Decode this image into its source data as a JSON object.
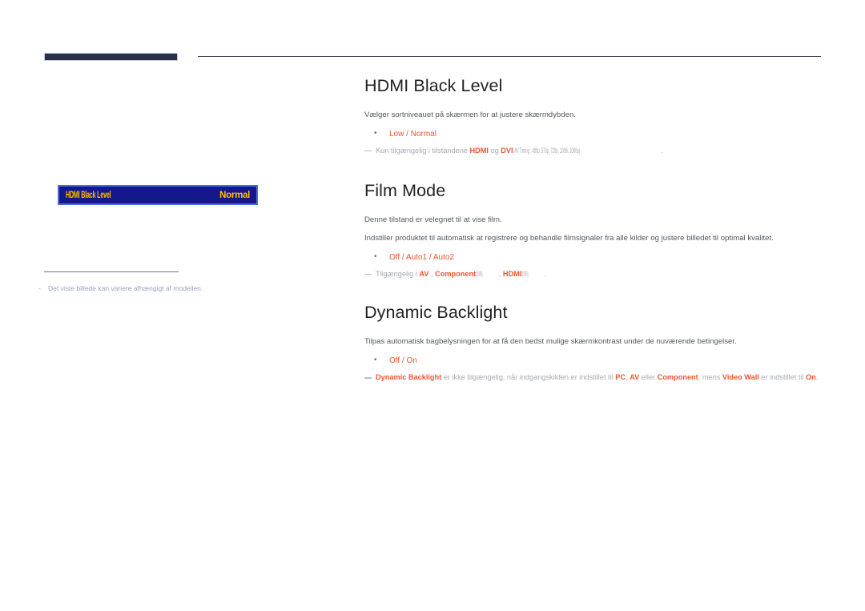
{
  "page": {
    "language": "Danish",
    "left_panel": {
      "osd": {
        "label": "HDMI Black Level",
        "value": "Normal",
        "bg_color": "#14188c",
        "border_color": "#4a6fd4",
        "text_color": "#ffc000"
      },
      "footnote": {
        "bullet": "-",
        "text": "Det viste billede kan variere afhængigt af modellen."
      }
    },
    "sections": [
      {
        "id": "hdmi-black-level",
        "title": "HDMI Black Level",
        "descriptions": [
          "Vælger sortniveauet på skærmen for at justere skærmdybden."
        ],
        "options": [
          "Low",
          "Normal"
        ],
        "options_separator": " / ",
        "notes": [
          {
            "parts": [
              {
                "text": "Kun tilgængelig i tilstandene ",
                "style": "plain"
              },
              {
                "text": "HDMI",
                "style": "highlight"
              },
              {
                "text": " og ",
                "style": "plain"
              },
              {
                "text": "DVI",
                "style": "highlight"
              },
              {
                "text": "(AV Timing : 480p, 576p, 720p, 1080i, 1080p)",
                "style": "squashed"
              },
              {
                "text": ".",
                "style": "plain"
              }
            ]
          }
        ]
      },
      {
        "id": "film-mode",
        "title": "Film Mode",
        "descriptions": [
          "Denne tilstand er velegnet til at vise film.",
          "Indstiller produktet til automatisk at registrere og behandle filmsignaler fra alle kilder og justere billedet til optimal kvalitet."
        ],
        "options": [
          "Off",
          "Auto1",
          "Auto2"
        ],
        "options_separator": " / ",
        "notes": [
          {
            "parts": [
              {
                "text": "Tilgængelig i ",
                "style": "plain"
              },
              {
                "text": "AV",
                "style": "highlight"
              },
              {
                "text": " , ",
                "style": "plain"
              },
              {
                "text": "Component",
                "style": "highlight"
              },
              {
                "text": " (1080i)",
                "style": "squashed"
              },
              {
                "text": ", ",
                "style": "plain"
              },
              {
                "text": "HDMI",
                "style": "highlight"
              },
              {
                "text": " (1080i)",
                "style": "squashed"
              },
              {
                "text": ".",
                "style": "plain"
              }
            ]
          }
        ]
      },
      {
        "id": "dynamic-backlight",
        "title": "Dynamic Backlight",
        "descriptions": [
          "Tilpas automatisk bagbelysningen for at få den bedst mulige skærmkontrast under de nuværende betingelser."
        ],
        "options": [
          "Off",
          "On"
        ],
        "options_separator": " / ",
        "notes": [
          {
            "parts": [
              {
                "text": "Dynamic Backlight",
                "style": "highlight"
              },
              {
                "text": " er ikke tilgængelig, når indgangskilden er indstillet til ",
                "style": "plain"
              },
              {
                "text": "PC",
                "style": "highlight"
              },
              {
                "text": ", ",
                "style": "plain"
              },
              {
                "text": "AV",
                "style": "highlight"
              },
              {
                "text": " eller ",
                "style": "plain"
              },
              {
                "text": "Component",
                "style": "highlight"
              },
              {
                "text": ", mens ",
                "style": "plain"
              },
              {
                "text": "Video Wall",
                "style": "highlight"
              },
              {
                "text": " er indstillet til ",
                "style": "plain"
              },
              {
                "text": "On",
                "style": "highlight"
              },
              {
                "text": ".",
                "style": "plain"
              }
            ]
          }
        ]
      }
    ]
  }
}
